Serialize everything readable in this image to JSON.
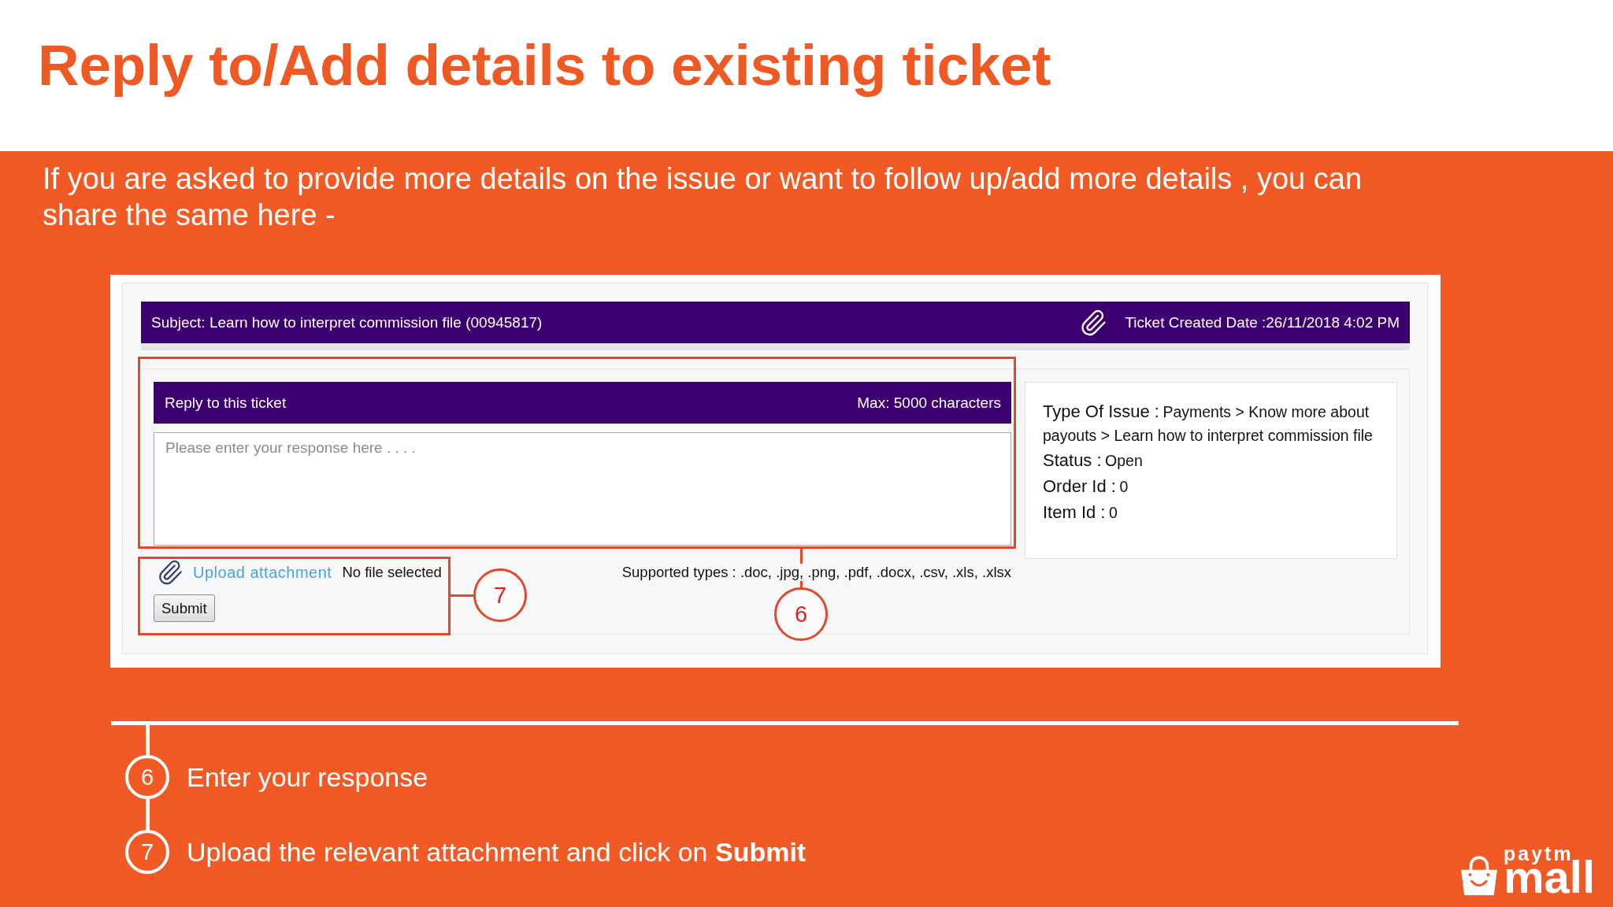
{
  "title": "Reply to/Add details to existing ticket",
  "intro": "If you are asked to provide more details on the issue or want to follow up/add more details , you can share the same here -",
  "ticket_screen": {
    "subject": "Subject: Learn how to interpret commission file (00945817)",
    "created_date": "Ticket Created Date :26/11/2018 4:02 PM",
    "reply_header": {
      "title": "Reply to this ticket",
      "limit": "Max: 5000 characters"
    },
    "response_field": {
      "placeholder": "Please enter your response here . . . ."
    },
    "upload_link": "Upload attachment",
    "file_status": "No file selected",
    "supported_types": "Supported types : .doc, .jpg, .png, .pdf, .docx, .csv, .xls, .xlsx",
    "submit_button": "Submit",
    "details": [
      {
        "label": "Type Of Issue :",
        "value": "Payments > Know more about payouts > Learn how to interpret commission file"
      },
      {
        "label": "Status :",
        "value": "Open"
      },
      {
        "label": "Order Id :",
        "value": "0"
      },
      {
        "label": "Item Id :",
        "value": "0"
      }
    ],
    "callouts": [
      {
        "kind": "reply",
        "number": "6"
      },
      {
        "kind": "upload",
        "number": "7"
      }
    ]
  },
  "steps": [
    {
      "number": "6",
      "text": "Enter your response"
    },
    {
      "number": "7",
      "text": "Upload the relevant attachment and click on **Submit**"
    }
  ],
  "logo": {
    "top": "paytm",
    "bottom": "mall"
  }
}
